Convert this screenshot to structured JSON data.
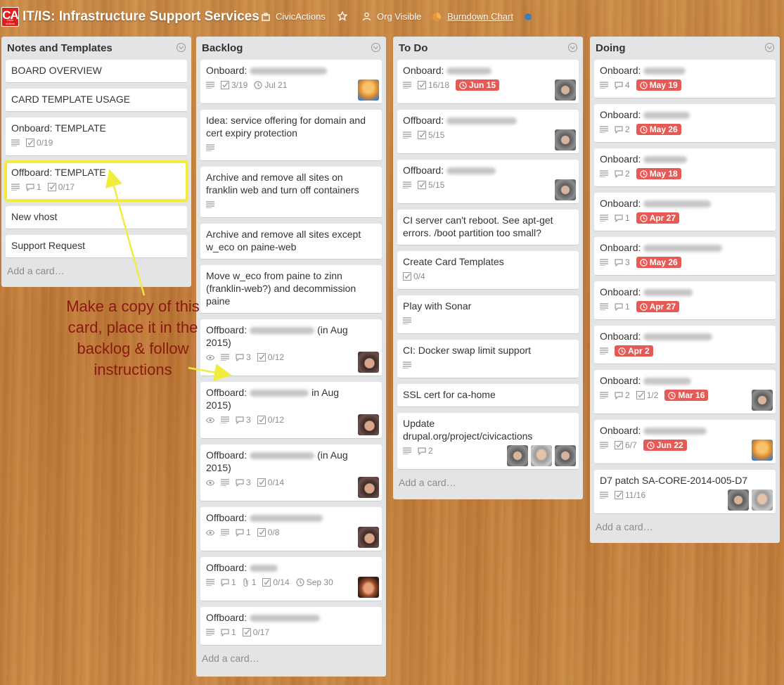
{
  "header": {
    "logo_text": "CA",
    "logo_subtext": "Civic Actions",
    "board_title": "IT/IS: Infrastructure Support Services",
    "org_name": "CivicActions",
    "visibility": "Org Visible",
    "burndown_link": "Burndown Chart"
  },
  "lists": [
    {
      "title": "Notes and Templates",
      "add_card": "Add a card…",
      "cards": [
        {
          "title": "BOARD OVERVIEW"
        },
        {
          "title": "CARD TEMPLATE USAGE"
        },
        {
          "title": "Onboard: TEMPLATE",
          "checklist": "0/19"
        },
        {
          "title": "Offboard: TEMPLATE",
          "comments": "1",
          "checklist": "0/17"
        },
        {
          "title": "New vhost"
        },
        {
          "title": "Support Request"
        }
      ]
    },
    {
      "title": "Backlog",
      "add_card": "Add a card…",
      "cards": [
        {
          "title": "Onboard:",
          "checklist": "3/19",
          "date": "Jul 21"
        },
        {
          "title": "Idea: service offering for domain and cert expiry protection"
        },
        {
          "title": "Archive and remove all sites on franklin web and turn off containers"
        },
        {
          "title": "Archive and remove all sites except w_eco on paine-web"
        },
        {
          "title": "Move w_eco from paine to zinn (franklin-web?) and decommission paine"
        },
        {
          "title": "Offboard:",
          "suffix": "(in Aug 2015)",
          "comments": "3",
          "checklist": "0/12"
        },
        {
          "title": "Offboard:",
          "suffix": "in Aug 2015)",
          "comments": "3",
          "checklist": "0/12"
        },
        {
          "title": "Offboard:",
          "suffix": "(in Aug 2015)",
          "comments": "3",
          "checklist": "0/14"
        },
        {
          "title": "Offboard:",
          "comments": "1",
          "checklist": "0/8"
        },
        {
          "title": "Offboard:",
          "comments": "1",
          "attachments": "1",
          "checklist": "0/14",
          "date": "Sep 30"
        },
        {
          "title": "Offboard:",
          "comments": "1",
          "checklist": "0/17"
        }
      ]
    },
    {
      "title": "To Do",
      "add_card": "Add a card…",
      "cards": [
        {
          "title": "Onboard:",
          "checklist": "16/18",
          "due": "Jun 15"
        },
        {
          "title": "Offboard:",
          "checklist": "5/15"
        },
        {
          "title": "Offboard:",
          "checklist": "5/15"
        },
        {
          "title": "CI server can't reboot. See apt-get errors. /boot partition too small?"
        },
        {
          "title": "Create Card Templates",
          "checklist": "0/4"
        },
        {
          "title": "Play with Sonar"
        },
        {
          "title": "CI: Docker swap limit support"
        },
        {
          "title": "SSL cert for ca-home"
        },
        {
          "title": "Update drupal.org/project/civicactions",
          "comments": "2"
        }
      ]
    },
    {
      "title": "Doing",
      "add_card": "Add a card…",
      "cards": [
        {
          "title": "Onboard:",
          "comments": "4",
          "due": "May 19"
        },
        {
          "title": "Onboard:",
          "comments": "2",
          "due": "May 26"
        },
        {
          "title": "Onboard:",
          "comments": "2",
          "due": "May 18"
        },
        {
          "title": "Onboard:",
          "comments": "1",
          "due": "Apr 27"
        },
        {
          "title": "Onboard:",
          "comments": "3",
          "due": "May 26"
        },
        {
          "title": "Onboard:",
          "comments": "1",
          "due": "Apr 27"
        },
        {
          "title": "Onboard:",
          "due": "Apr 2"
        },
        {
          "title": "Onboard:",
          "comments": "2",
          "checklist": "1/2",
          "due": "Mar 16"
        },
        {
          "title": "Onboard:",
          "checklist": "6/7",
          "due": "Jun 22"
        },
        {
          "title": "D7 patch SA-CORE-2014-005-D7",
          "checklist": "11/16"
        }
      ]
    }
  ],
  "annotation": "Make a copy of this card, place it in the backlog & follow instructions",
  "colors": {
    "due_badge": "#e55a55",
    "highlight": "#f2ec3f",
    "annotation": "#8a1a10",
    "list_bg": "#e2e4e6"
  }
}
